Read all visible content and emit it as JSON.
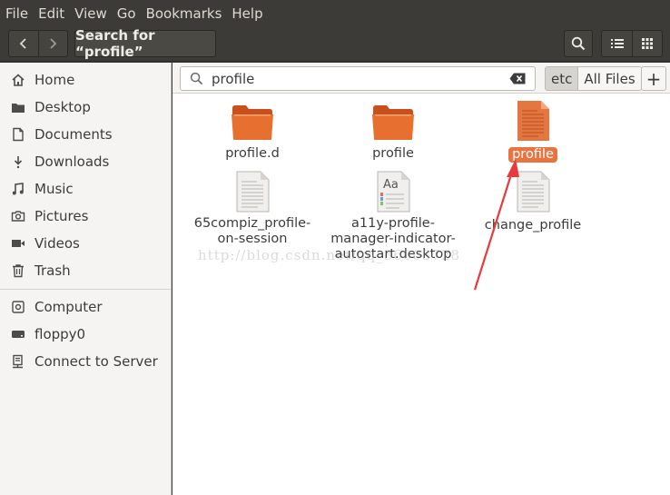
{
  "menubar": {
    "items": [
      "File",
      "Edit",
      "View",
      "Go",
      "Bookmarks",
      "Help"
    ]
  },
  "header": {
    "path_button": "Search for “profile”",
    "icons": {
      "back": "chevron-left-icon",
      "forward": "chevron-right-icon",
      "search": "search-icon",
      "list_view": "list-view-icon",
      "grid_view": "grid-view-icon"
    }
  },
  "sidebar": {
    "places": [
      {
        "label": "Home",
        "icon": "home-icon"
      },
      {
        "label": "Desktop",
        "icon": "desktop-folder-icon"
      },
      {
        "label": "Documents",
        "icon": "document-icon"
      },
      {
        "label": "Downloads",
        "icon": "download-icon"
      },
      {
        "label": "Music",
        "icon": "music-icon"
      },
      {
        "label": "Pictures",
        "icon": "camera-icon"
      },
      {
        "label": "Videos",
        "icon": "video-icon"
      },
      {
        "label": "Trash",
        "icon": "trash-icon"
      }
    ],
    "devices": [
      {
        "label": "Computer",
        "icon": "computer-icon"
      },
      {
        "label": "floppy0",
        "icon": "drive-icon"
      },
      {
        "label": "Connect to Server",
        "icon": "server-icon"
      }
    ]
  },
  "search": {
    "value": "profile",
    "placeholder": "",
    "location_options": [
      "etc",
      "All Files"
    ],
    "selected_location": "etc"
  },
  "files": [
    {
      "name": "profile.d",
      "type": "folder",
      "selected": false
    },
    {
      "name": "profile",
      "type": "folder",
      "selected": false
    },
    {
      "name": "profile",
      "type": "text-file",
      "selected": true
    },
    {
      "name": "65compiz_profile-on-session",
      "lines": [
        "65compiz_profile-",
        "on-session"
      ],
      "type": "text-file",
      "selected": false
    },
    {
      "name": "a11y-profile-manager-indicator-autostart.desktop",
      "lines": [
        "a11y-profile-",
        "manager-indicator-",
        "autostart.desktop"
      ],
      "type": "font-file",
      "selected": false
    },
    {
      "name": "change_profile",
      "type": "text-file",
      "selected": false
    }
  ],
  "watermark": "http://blog.csdn.net/qq_36003728",
  "colors": {
    "selection": "#e9743f",
    "folder_orange": "#e8702f",
    "annotation_arrow": "#e83a3a",
    "header_dark": "#3c3b37"
  }
}
